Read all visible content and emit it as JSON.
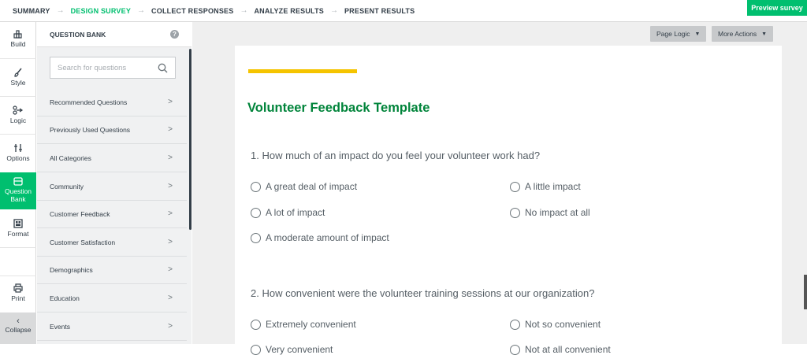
{
  "topnav": {
    "steps": [
      "SUMMARY",
      "DESIGN SURVEY",
      "COLLECT RESPONSES",
      "ANALYZE RESULTS",
      "PRESENT RESULTS"
    ],
    "active_step": "DESIGN SURVEY",
    "preview_label": "Preview survey"
  },
  "rail": {
    "build": "Build",
    "style": "Style",
    "logic": "Logic",
    "options": "Options",
    "question_bank_1": "Question",
    "question_bank_2": "Bank",
    "format": "Format",
    "print": "Print",
    "collapse": "Collapse"
  },
  "bank": {
    "header": "QUESTION BANK",
    "help": "?",
    "search_placeholder": "Search for questions",
    "categories": [
      "Recommended Questions",
      "Previously Used Questions",
      "All Categories",
      "Community",
      "Customer Feedback",
      "Customer Satisfaction",
      "Demographics",
      "Education",
      "Events"
    ]
  },
  "toolbar": {
    "page_logic": "Page Logic",
    "more_actions": "More Actions"
  },
  "survey": {
    "title": "Volunteer Feedback Template",
    "q1": {
      "text": "1. How much of an impact do you feel your volunteer work had?",
      "options": [
        "A great deal of impact",
        "A little impact",
        "A lot of impact",
        "No impact at all",
        "A moderate amount of impact"
      ]
    },
    "q2": {
      "text": "2. How convenient were the volunteer training sessions at our organization?",
      "options": [
        "Extremely convenient",
        "Not so convenient",
        "Very convenient",
        "Not at all convenient"
      ]
    }
  },
  "colors": {
    "accent": "#00bf6f",
    "title_green": "#00843a",
    "highlight_yellow": "#f5c400"
  }
}
